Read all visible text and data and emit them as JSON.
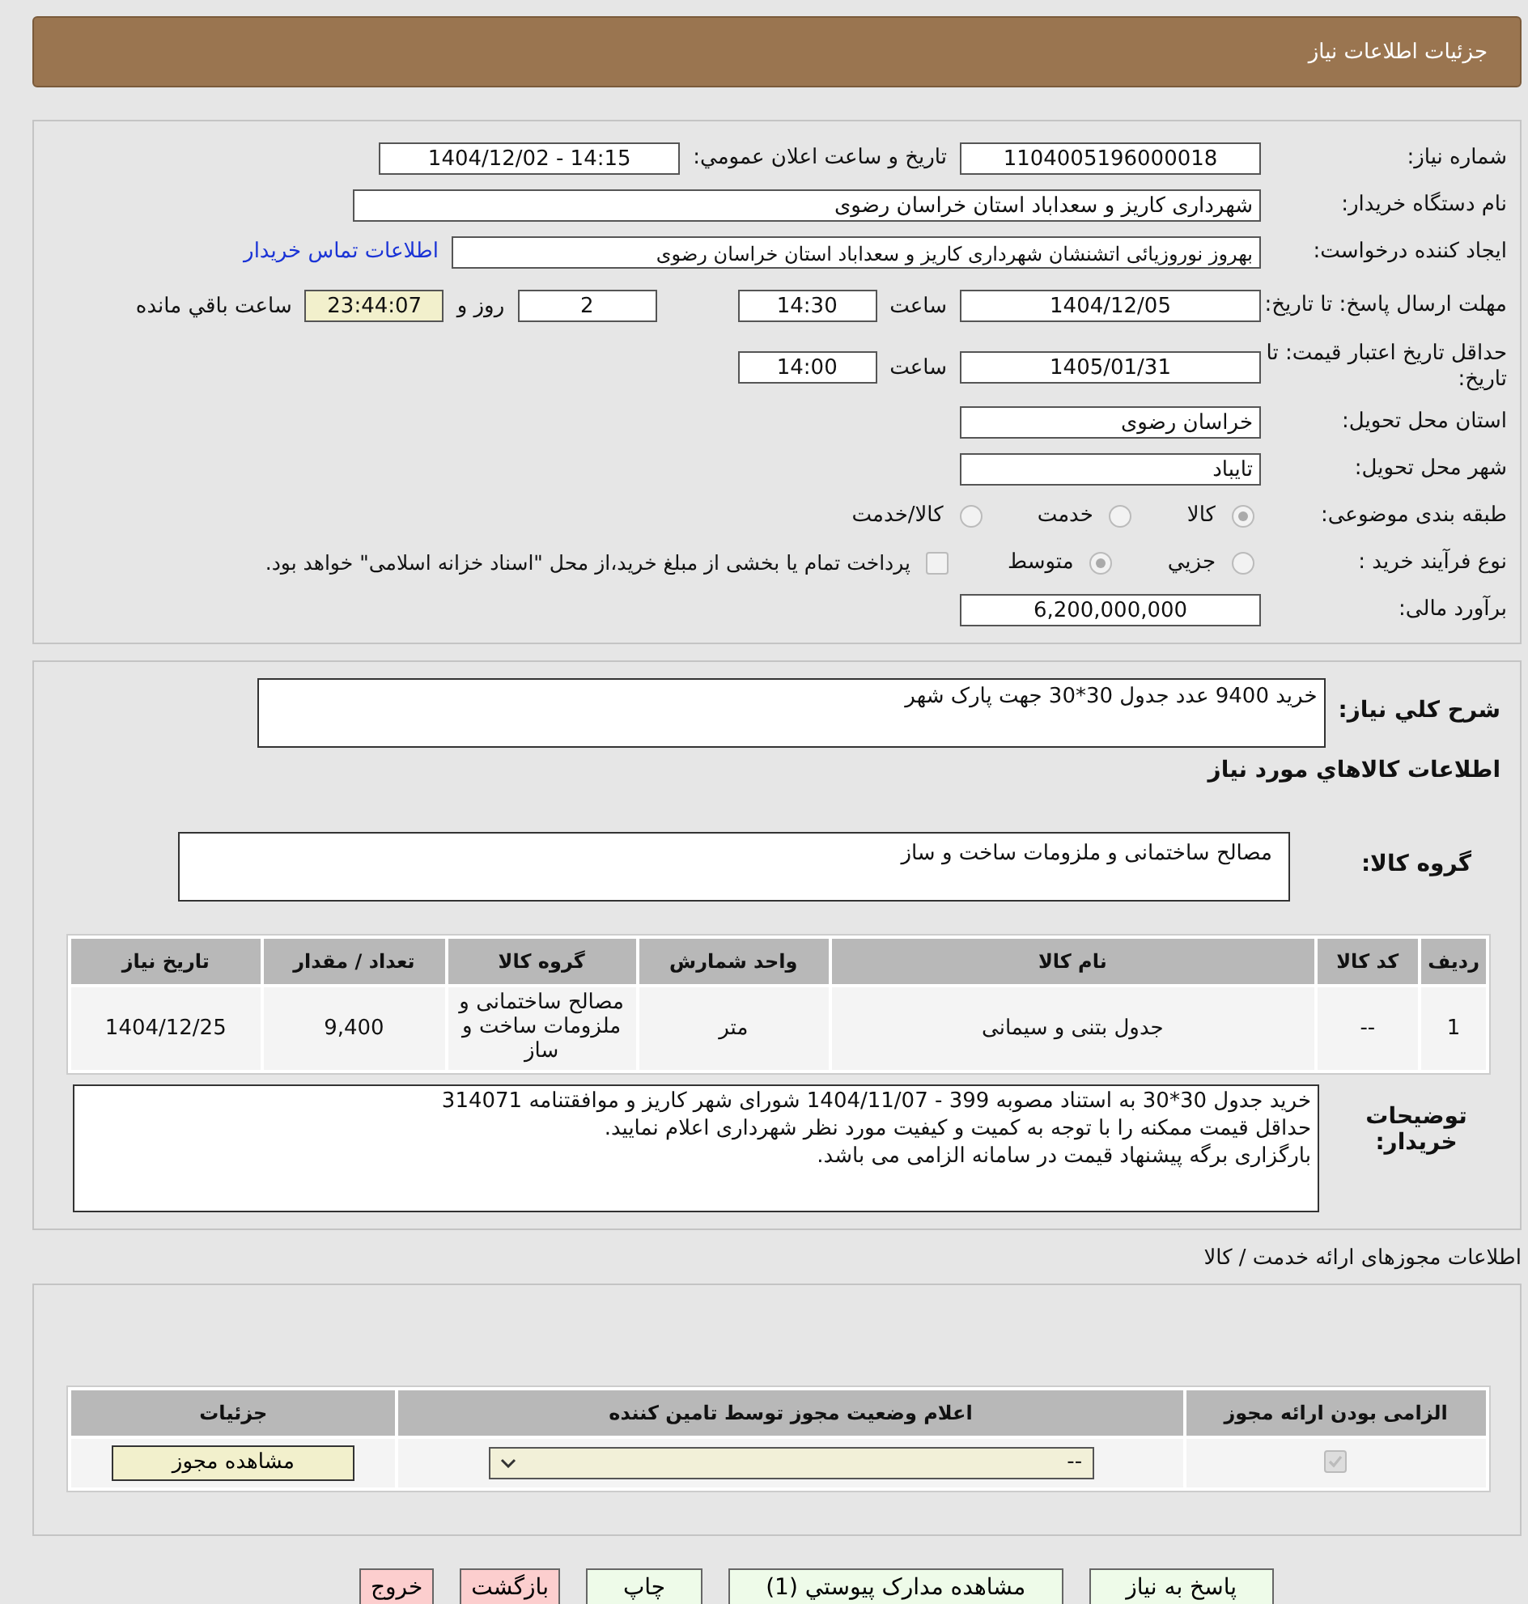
{
  "header": {
    "title": "جزئیات اطلاعات نیاز"
  },
  "form": {
    "need_number": {
      "label": "شماره نیاز:",
      "value": "1104005196000018"
    },
    "announce": {
      "label": "تاریخ و ساعت اعلان عمومي:",
      "value": "1404/12/02 - 14:15"
    },
    "buyer_org": {
      "label": "نام دستگاه خریدار:",
      "value": "شهرداری کاریز و سعداباد استان خراسان رضوی"
    },
    "creator": {
      "label": "ایجاد کننده درخواست:",
      "value": "بهروز نوروزیائی اتشنشان شهرداری کاریز و سعداباد استان خراسان رضوی",
      "link": "اطلاعات تماس خریدار"
    },
    "deadline": {
      "label": "مهلت ارسال پاسخ: تا تاریخ:",
      "date": "1404/12/05",
      "time_label": "ساعت",
      "time": "14:30",
      "days": "2",
      "days_label": "روز و",
      "remaining": "23:44:07",
      "remaining_label": "ساعت باقي مانده"
    },
    "validity": {
      "label": "حداقل تاریخ اعتبار قیمت: تا تاریخ:",
      "date": "1405/01/31",
      "time_label": "ساعت",
      "time": "14:00"
    },
    "province": {
      "label": "استان محل تحویل:",
      "value": "خراسان رضوی"
    },
    "city": {
      "label": "شهر محل تحویل:",
      "value": "تایباد"
    },
    "category": {
      "label": "طبقه بندی موضوعی:",
      "options": [
        {
          "label": "کالا",
          "selected": true
        },
        {
          "label": "خدمت",
          "selected": false
        },
        {
          "label": "کالا/خدمت",
          "selected": false
        }
      ]
    },
    "process": {
      "label": "نوع فرآیند خرید :",
      "options": [
        {
          "label": "جزیي",
          "selected": false
        },
        {
          "label": "متوسط",
          "selected": true
        }
      ],
      "treasury": {
        "label": "پرداخت تمام یا بخشی از مبلغ خرید،از محل \"اسناد خزانه اسلامی\" خواهد بود.",
        "checked": false
      }
    },
    "budget": {
      "label": "برآورد مالی:",
      "value": "6,200,000,000"
    }
  },
  "details": {
    "summary": {
      "label": "شرح كلي نیاز:",
      "value": "خرید 9400 عدد جدول 30*30 جهت پارک شهر"
    },
    "goods_heading": "اطلاعات كالاهاي مورد نياز",
    "group": {
      "label": "گروه کالا:",
      "value": "مصالح ساختمانی و ملزومات ساخت و ساز"
    },
    "table": {
      "columns": [
        "ردیف",
        "کد کالا",
        "نام کالا",
        "واحد شمارش",
        "گروه کالا",
        "تعداد / مقدار",
        "تاریخ نیاز"
      ],
      "rows": [
        [
          "1",
          "--",
          "جدول بتنی و سیمانی",
          "متر",
          "مصالح ساختمانی و ملزومات ساخت و ساز",
          "9,400",
          "1404/12/25"
        ]
      ]
    },
    "notes": {
      "label": "توضیحات خریدار:",
      "lines": [
        "خرید جدول 30*30 به استناد مصوبه 399  - 1404/11/07 شورای شهر کاریز  و موافقتنامه 314071",
        "حداقل قیمت ممکنه را با توجه به کمیت و کیفیت مورد نظر شهرداری اعلام نمایید.",
        "بارگزاری برگه پیشنهاد قیمت در سامانه الزامی می باشد."
      ]
    }
  },
  "permits": {
    "title": "اطلاعات مجوزهای ارائه خدمت / کالا",
    "columns": [
      "الزامی بودن ارائه مجوز",
      "اعلام وضعیت مجوز توسط تامین کننده",
      "جزئیات"
    ],
    "rows": [
      {
        "required": true,
        "status": "--",
        "button": "مشاهده مجوز"
      }
    ]
  },
  "buttons": [
    {
      "label": "پاسخ به نیاز",
      "kind": "action"
    },
    {
      "label": "مشاهده مدارک پیوستي (1)",
      "kind": "action"
    },
    {
      "label": "چاپ",
      "kind": "action"
    },
    {
      "label": "بازگشت",
      "kind": "exit"
    },
    {
      "label": "خروج",
      "kind": "exit"
    }
  ]
}
